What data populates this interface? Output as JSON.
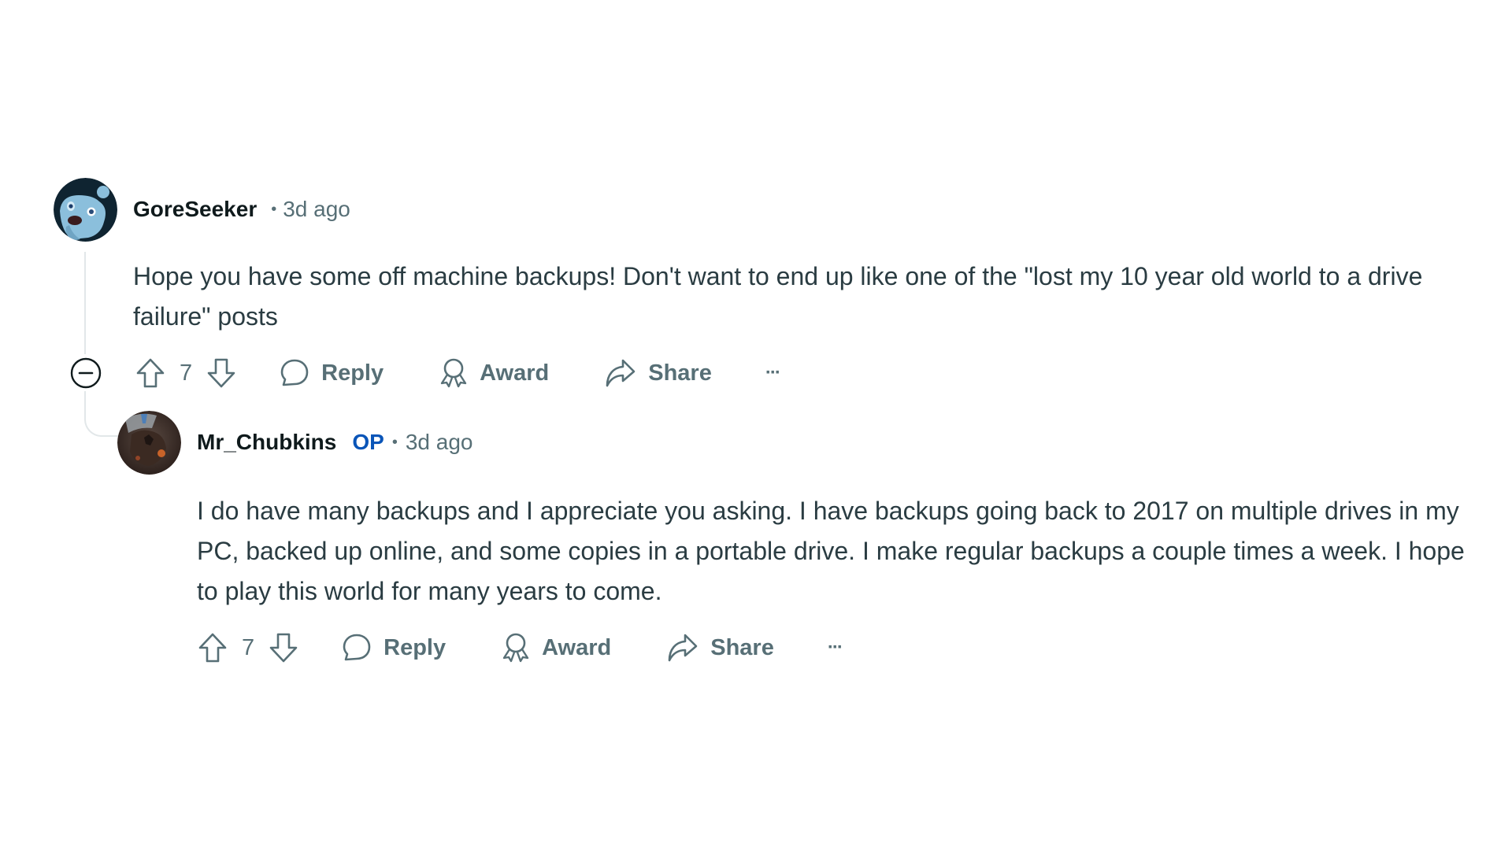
{
  "comments": [
    {
      "username": "GoreSeeker",
      "is_op": false,
      "separator": "•",
      "timestamp": "3d ago",
      "avatar": "snoo-avatar-light-blue",
      "body": "Hope you have some off machine backups! Don't want to end up like one of the \"lost my 10 year old world to a drive failure\" posts",
      "score": "7",
      "actions": {
        "reply": "Reply",
        "award": "Award",
        "share": "Share",
        "more": "···"
      }
    },
    {
      "username": "Mr_Chubkins",
      "is_op": true,
      "op_label": "OP",
      "separator": "•",
      "timestamp": "3d ago",
      "avatar": "dark-fantasy-avatar",
      "body": "I do have many backups and I appreciate you asking. I have backups going back to 2017 on multiple drives in my PC, backed up online, and some copies in a portable drive. I make regular backups a couple times a week. I hope to play this world for many years to come.",
      "score": "7",
      "actions": {
        "reply": "Reply",
        "award": "Award",
        "share": "Share",
        "more": "···"
      }
    }
  ],
  "icons": {
    "collapse": "collapse-minus-circle-icon",
    "upvote": "upvote-arrow-icon",
    "downvote": "downvote-arrow-icon",
    "reply": "comment-bubble-icon",
    "award": "award-ribbon-icon",
    "share": "share-arrow-icon",
    "more": "more-dots-icon"
  },
  "colors": {
    "op_badge": "#0a55b8",
    "meta_text": "#576f76",
    "username": "#0f1a1c",
    "thread_line": "#e2e7e9"
  }
}
